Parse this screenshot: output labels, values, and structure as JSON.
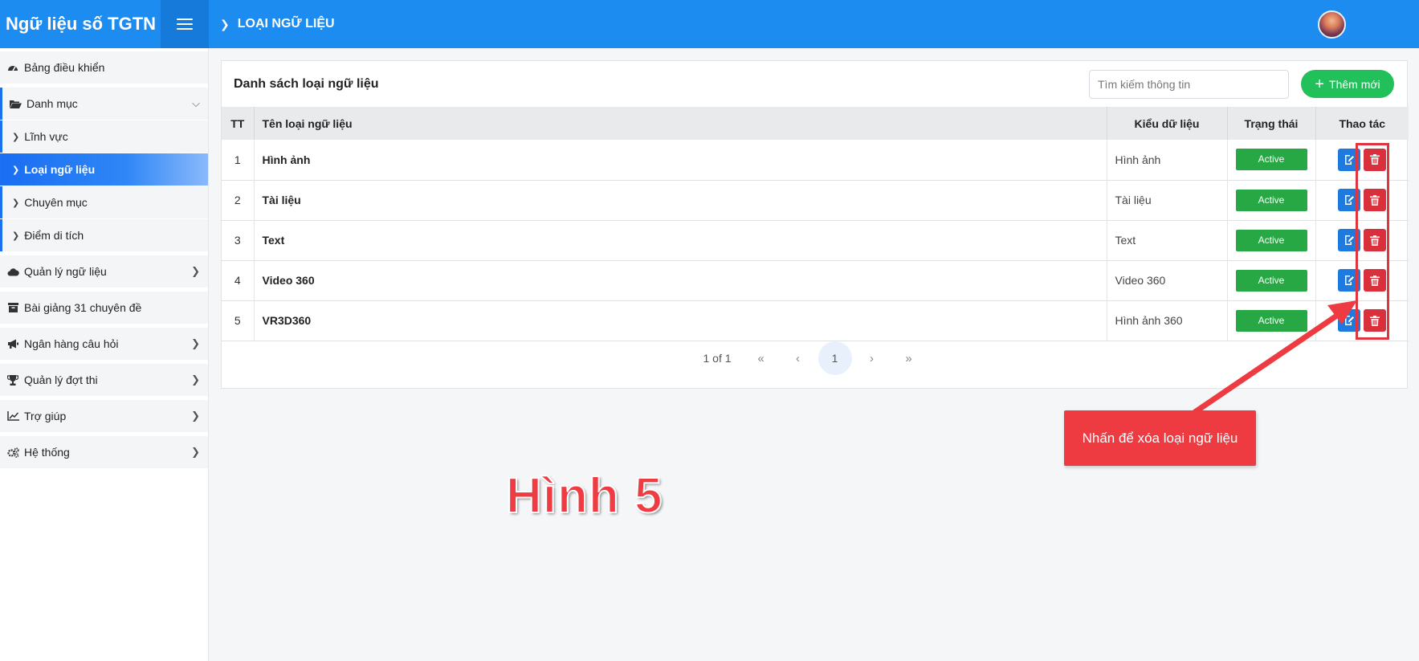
{
  "app": {
    "brand": "Ngữ liệu số TGTN",
    "page_title": "LOẠI NGỮ LIỆU"
  },
  "sidebar": {
    "dashboard": "Bảng điều khiển",
    "catalog": "Danh mục",
    "catalog_items": [
      "Lĩnh vực",
      "Loại ngữ liệu",
      "Chuyên mục",
      "Điểm di tích"
    ],
    "data_mgmt": "Quản lý ngữ liệu",
    "lectures": "Bài giảng 31 chuyên đề",
    "question_bank": "Ngân hàng câu hỏi",
    "exam_mgmt": "Quản lý đợt thi",
    "help": "Trợ giúp",
    "system": "Hệ thống"
  },
  "card": {
    "title": "Danh sách loại ngữ liệu",
    "search_placeholder": "Tìm kiếm thông tin",
    "add_label": "Thêm mới"
  },
  "table": {
    "headers": {
      "tt": "TT",
      "name": "Tên loại ngữ liệu",
      "type": "Kiểu dữ liệu",
      "status": "Trạng thái",
      "actions": "Thao tác"
    },
    "rows": [
      {
        "tt": "1",
        "name": "Hình ảnh",
        "type": "Hình ảnh",
        "status": "Active"
      },
      {
        "tt": "2",
        "name": "Tài liệu",
        "type": "Tài liệu",
        "status": "Active"
      },
      {
        "tt": "3",
        "name": "Text",
        "type": "Text",
        "status": "Active"
      },
      {
        "tt": "4",
        "name": "Video 360",
        "type": "Video 360",
        "status": "Active"
      },
      {
        "tt": "5",
        "name": "VR3D360",
        "type": "Hình ảnh 360",
        "status": "Active"
      }
    ]
  },
  "pager": {
    "info": "1 of 1",
    "first": "«",
    "prev": "‹",
    "current": "1",
    "next": "›",
    "last": "»"
  },
  "annotation": {
    "callout": "Nhấn để xóa loại ngữ liệu",
    "figure_label": "Hình 5"
  },
  "colors": {
    "primary": "#1c8cf0",
    "success": "#28a745",
    "add": "#22c05a",
    "danger": "#d9303c",
    "annotation": "#ee3b42"
  }
}
